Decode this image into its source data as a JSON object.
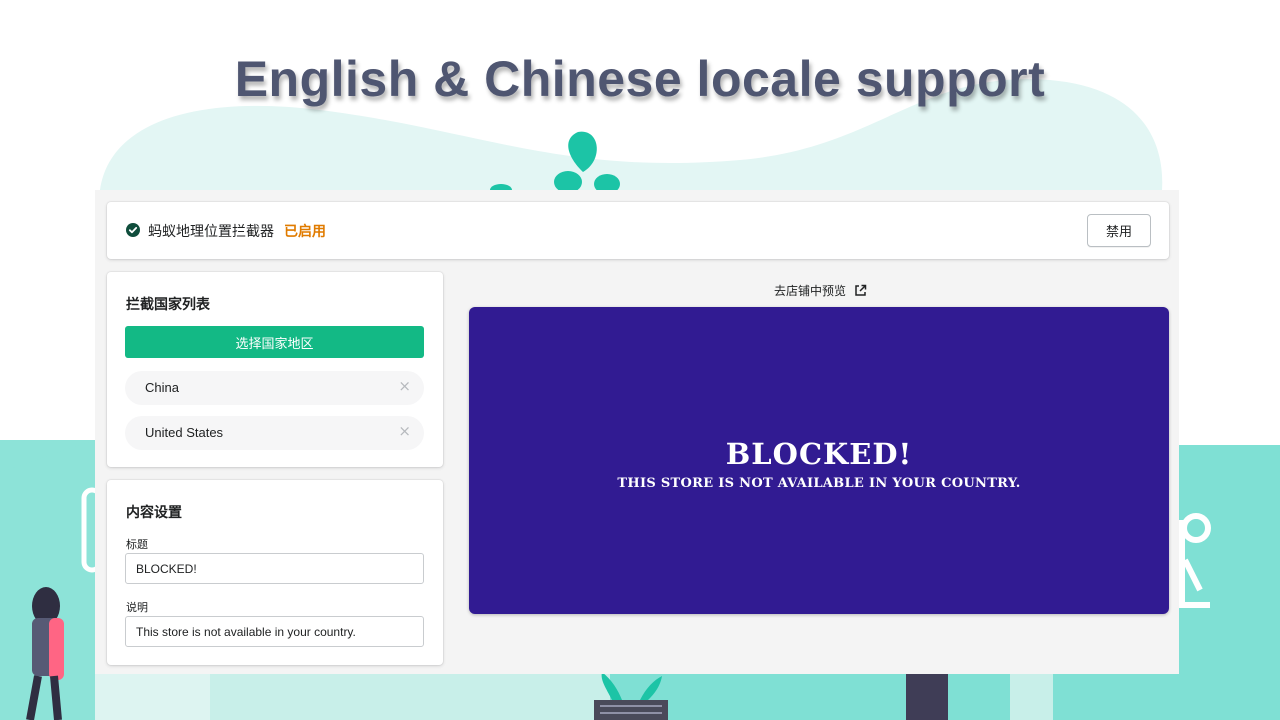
{
  "headline": "English & Chinese locale support",
  "colors": {
    "accent": "#13b985",
    "enabled": "#e07b00",
    "preview_bg": "#311b92",
    "decor_teal": "#7fe0d4",
    "decor_mint": "#e3f6f4"
  },
  "status": {
    "icon": "check-circle-icon",
    "app_name": "蚂蚁地理位置拦截器",
    "state": "已启用",
    "disable_label": "禁用"
  },
  "countries": {
    "title": "拦截国家列表",
    "select_label": "选择国家地区",
    "items": [
      {
        "label": "China",
        "remove": "×"
      },
      {
        "label": "United States",
        "remove": "×"
      }
    ]
  },
  "content": {
    "title": "内容设置",
    "title_label": "标题",
    "title_value": "BLOCKED!",
    "desc_label": "说明",
    "desc_value": "This store is not available in your country."
  },
  "preview": {
    "link_label": "去店铺中预览",
    "link_icon": "external-link-icon",
    "title": "BLOCKED!",
    "desc": "This store is not available in your country."
  }
}
